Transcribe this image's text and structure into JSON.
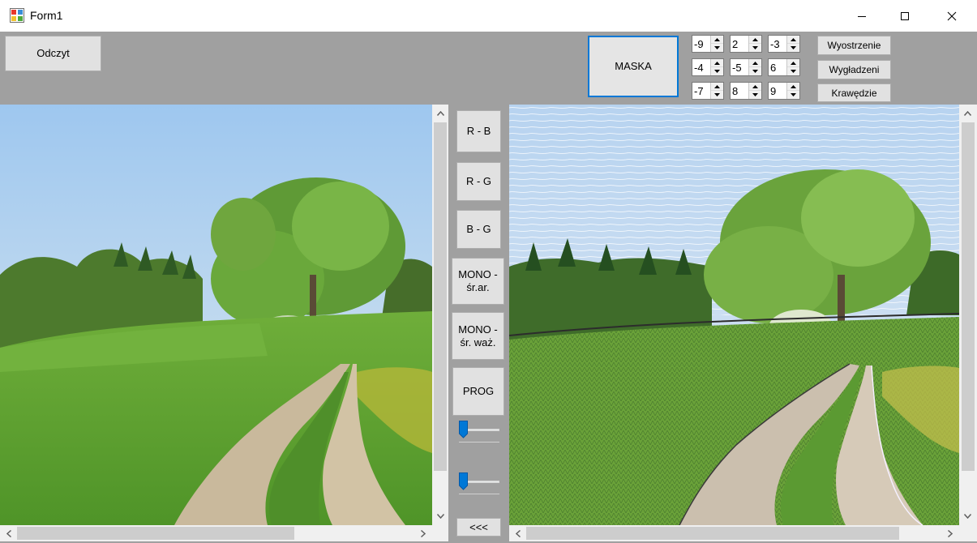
{
  "window": {
    "title": "Form1",
    "icon": "winforms-app-icon",
    "controls": [
      "minimize-icon",
      "maximize-icon",
      "close-icon"
    ]
  },
  "toolbar": {
    "read_label": "Odczyt",
    "mask_label": "MASKA",
    "sharpen_label": "Wyostrzenie",
    "smooth_label": "Wygładzeni",
    "edges_label": "Krawędzie"
  },
  "mask": {
    "row1": [
      "-9",
      "2",
      "-3"
    ],
    "row2": [
      "-4",
      "-5",
      "6"
    ],
    "row3": [
      "-7",
      "8",
      "9"
    ]
  },
  "middle": {
    "rb_label": "R - B",
    "rg_label": "R - G",
    "bg_label": "B - G",
    "mono_avg_label": "MONO -\nśr.ar.",
    "mono_weighted_label": "MONO -\nśr. waż.",
    "threshold_label": "PROG",
    "back_label": "<<<",
    "slider1_value": 0,
    "slider2_value": 0
  },
  "images": {
    "left": "landscape-original",
    "right": "landscape-embossed"
  },
  "colors": {
    "form_bg": "#a0a0a0",
    "button_bg": "#e1e1e1",
    "accent": "#0078d7"
  }
}
